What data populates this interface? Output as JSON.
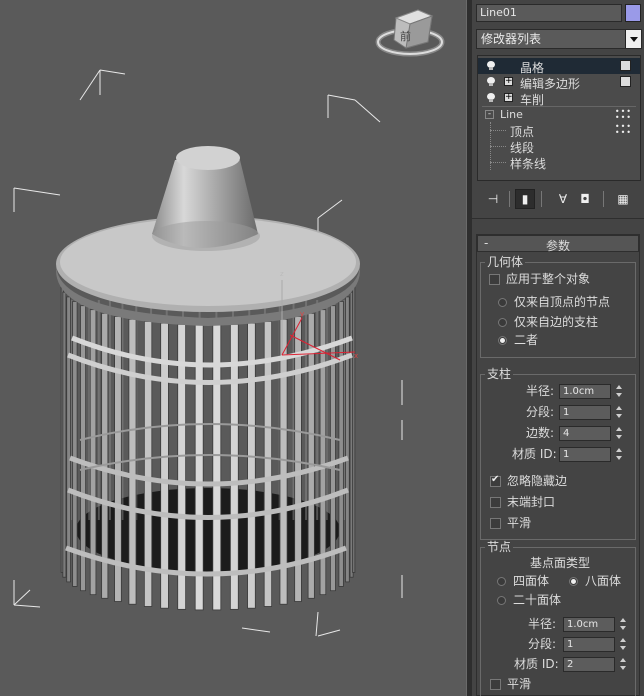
{
  "object_name": "Line01",
  "object_color": "#9a9ae8",
  "modifier_list": "修改器列表",
  "stack": {
    "items": [
      {
        "label": "晶格",
        "selected": true
      },
      {
        "label": "编辑多边形",
        "selected": false
      },
      {
        "label": "车削",
        "selected": false
      }
    ],
    "base": {
      "label": "Line",
      "children": [
        "顶点",
        "线段",
        "样条线"
      ]
    }
  },
  "viewcube_label": "前",
  "params": {
    "title": "参数",
    "geometry": {
      "title": "几何体",
      "apply_all": "应用于整个对象",
      "options": [
        "仅来自顶点的节点",
        "仅来自边的支柱",
        "二者"
      ],
      "selected": 2
    },
    "struts": {
      "title": "支柱",
      "radius_label": "半径:",
      "radius": "1.0cm",
      "segments_label": "分段:",
      "segments": "1",
      "sides_label": "边数:",
      "sides": "4",
      "matid_label": "材质 ID:",
      "matid": "1",
      "ignore_hidden": "忽略隐藏边",
      "end_caps": "末端封口",
      "smooth": "平滑"
    },
    "joints": {
      "title": "节点",
      "type_label": "基点面类型",
      "types": [
        "四面体",
        "八面体",
        "二十面体"
      ],
      "selected": 1,
      "radius_label": "半径:",
      "radius": "1.0cm",
      "segments_label": "分段:",
      "segments": "1",
      "matid_label": "材质 ID:",
      "matid": "2",
      "smooth": "平滑"
    }
  }
}
